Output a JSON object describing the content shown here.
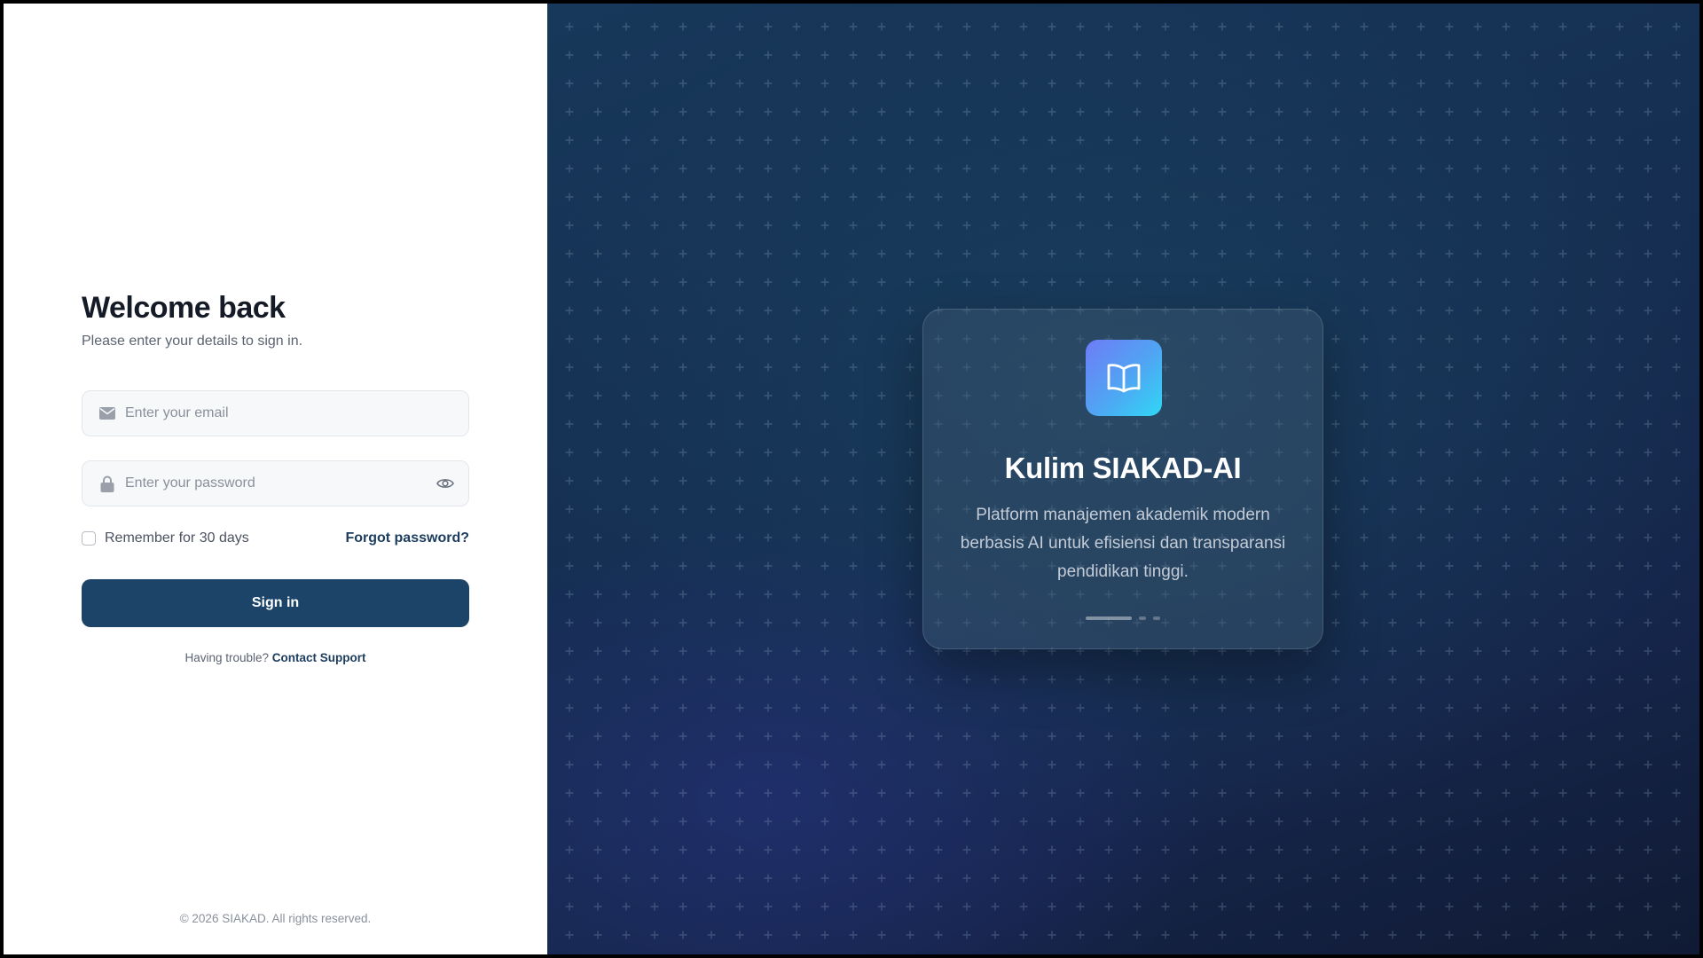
{
  "login": {
    "title": "Welcome back",
    "subtitle": "Please enter your details to sign in.",
    "email_placeholder": "Enter your email",
    "password_placeholder": "Enter your password",
    "remember_label": "Remember for 30 days",
    "forgot_label": "Forgot password?",
    "signin_label": "Sign in",
    "trouble_text": "Having trouble? ",
    "contact_label": "Contact Support",
    "footer": "© 2026 SIAKAD. All rights reserved."
  },
  "icons": {
    "email": "mail-icon",
    "password": "lock-icon",
    "toggle": "eye-icon",
    "logo": "book-open-icon"
  },
  "hero": {
    "title": "Kulim SIAKAD-AI",
    "description": "Platform manajemen akademik modern berbasis AI untuk efisiensi dan transparansi pendidikan tinggi.",
    "carousel": {
      "slides": 3,
      "active": 1
    }
  },
  "colors": {
    "primary": "#1b4468",
    "link": "#1c3d5e",
    "hero_bg": "#152f52",
    "logo_gradient_start": "#6e7cf6",
    "logo_gradient_end": "#2fd8f5"
  }
}
